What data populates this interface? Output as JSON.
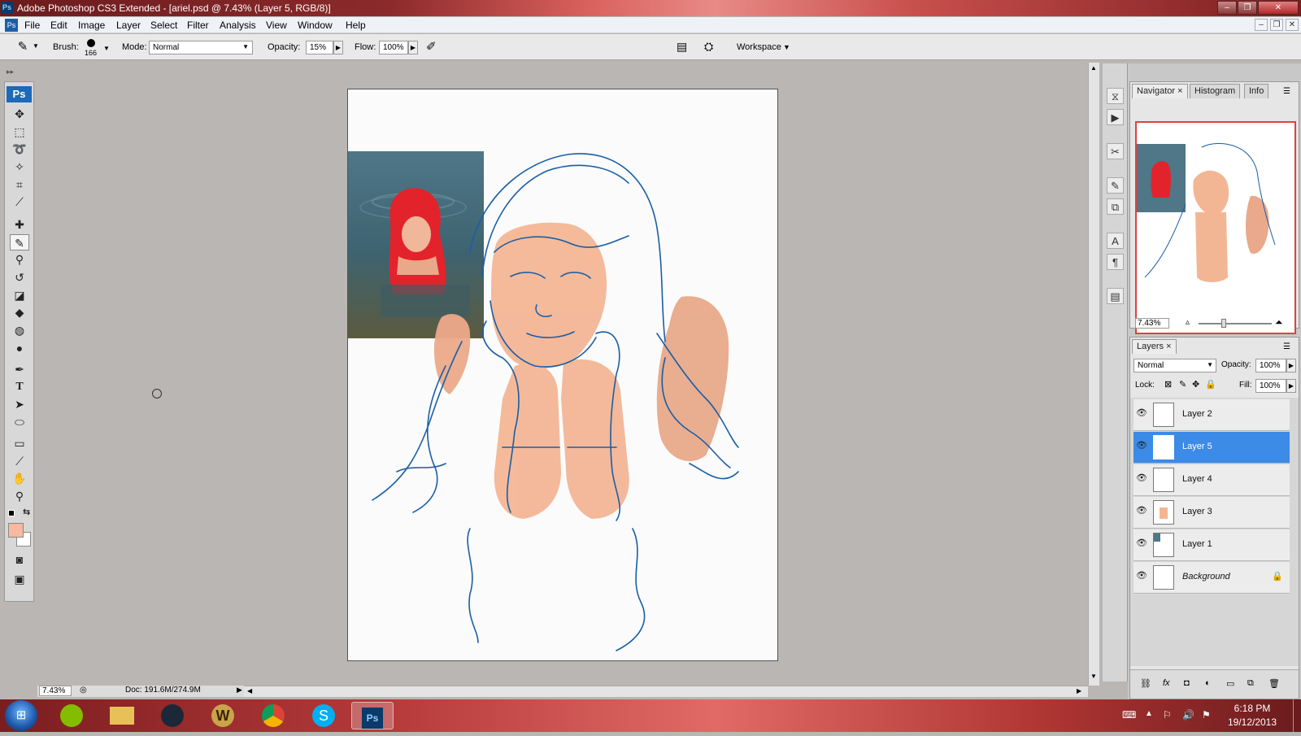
{
  "titlebar": {
    "app_icon": "Ps",
    "title": "Adobe Photoshop CS3 Extended - [ariel.psd @ 7.43% (Layer 5, RGB/8)]"
  },
  "menubar": {
    "items": [
      "File",
      "Edit",
      "Image",
      "Layer",
      "Select",
      "Filter",
      "Analysis",
      "View",
      "Window",
      "Help"
    ]
  },
  "options": {
    "brush_label": "Brush:",
    "brush_size": "166",
    "mode_label": "Mode:",
    "mode_value": "Normal",
    "opacity_label": "Opacity:",
    "opacity_value": "15%",
    "flow_label": "Flow:",
    "flow_value": "100%",
    "workspace_label": "Workspace"
  },
  "toolbox": {
    "logo": "Ps"
  },
  "status": {
    "zoom": "7.43%",
    "doc_info": "Doc: 191.6M/274.9M"
  },
  "navigator": {
    "tabs": [
      "Navigator",
      "Histogram",
      "Info"
    ],
    "zoom": "7.43%"
  },
  "layers_panel": {
    "tab": "Layers",
    "blend_mode": "Normal",
    "opacity_label": "Opacity:",
    "opacity_value": "100%",
    "lock_label": "Lock:",
    "fill_label": "Fill:",
    "fill_value": "100%",
    "layers": [
      {
        "name": "Layer 2",
        "selected": false
      },
      {
        "name": "Layer 5",
        "selected": true
      },
      {
        "name": "Layer 4",
        "selected": false
      },
      {
        "name": "Layer 3",
        "selected": false
      },
      {
        "name": "Layer 1",
        "selected": false
      },
      {
        "name": "Background",
        "selected": false,
        "locked": true
      }
    ]
  },
  "taskbar": {
    "apps": [
      "spotify-icon",
      "file-explorer-icon",
      "steam-icon",
      "warcraft-icon",
      "chrome-icon",
      "skype-icon",
      "photoshop-icon"
    ],
    "time": "6:18 PM",
    "date": "19/12/2013"
  },
  "colors": {
    "foreground": "#f7b9a0",
    "skin": "#f2b493",
    "sketch": "#1a5ea6",
    "selection": "#3c8be6"
  }
}
